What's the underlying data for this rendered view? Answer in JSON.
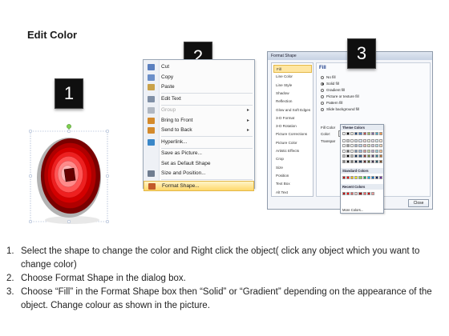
{
  "title": "Edit Color",
  "badges": [
    "1",
    "2",
    "3"
  ],
  "context_menu": {
    "items": [
      {
        "label": "Cut",
        "icon": "scissors-icon",
        "state": "normal"
      },
      {
        "label": "Copy",
        "icon": "copy-icon",
        "state": "normal"
      },
      {
        "label": "Paste",
        "icon": "paste-icon",
        "state": "normal"
      },
      {
        "label": "Edit Text",
        "icon": "edit-text-icon",
        "state": "normal"
      },
      {
        "label": "Group",
        "icon": "group-icon",
        "state": "disabled",
        "submenu": true
      },
      {
        "label": "Bring to Front",
        "icon": "bring-front-icon",
        "state": "normal",
        "submenu": true
      },
      {
        "label": "Send to Back",
        "icon": "send-back-icon",
        "state": "normal",
        "submenu": true
      },
      {
        "label": "Hyperlink...",
        "icon": "globe-icon",
        "state": "normal"
      },
      {
        "label": "Save as Picture...",
        "icon": "",
        "state": "normal"
      },
      {
        "label": "Set as Default Shape",
        "icon": "",
        "state": "normal"
      },
      {
        "label": "Size and Position...",
        "icon": "size-icon",
        "state": "normal"
      },
      {
        "label": "Format Shape...",
        "icon": "format-shape-icon",
        "state": "highlighted"
      }
    ]
  },
  "dialog": {
    "title": "Format Shape",
    "nav": [
      "Fill",
      "Line Color",
      "Line Style",
      "Shadow",
      "Reflection",
      "Glow and Soft Edges",
      "3-D Format",
      "3-D Rotation",
      "Picture Corrections",
      "Picture Color",
      "Artistic Effects",
      "Crop",
      "Size",
      "Position",
      "Text Box",
      "Alt Text"
    ],
    "selected_nav": "Fill",
    "fill_heading": "Fill",
    "options": [
      "No fill",
      "Solid fill",
      "Gradient fill",
      "Picture or texture fill",
      "Pattern fill",
      "Slide background fill"
    ],
    "selected_option": "Solid fill",
    "fill_color_label": "Fill Color",
    "color_label": "Color:",
    "transparency_label": "Transpar",
    "theme_colors_label": "Theme Colors",
    "standard_colors_label": "Standard Colors",
    "recent_colors_label": "Recent Colors",
    "more_colors_label": "More Colors...",
    "close_label": "Close",
    "theme_color_columns": [
      "#ffffff",
      "#000000",
      "#eeece1",
      "#1f497d",
      "#4f81bd",
      "#c0504d",
      "#9bbb59",
      "#8064a2",
      "#4bacc6",
      "#f79646"
    ],
    "standard_colors": [
      "#c00000",
      "#ff0000",
      "#ffc000",
      "#ffff00",
      "#92d050",
      "#00b050",
      "#00b0f0",
      "#0070c0",
      "#002060",
      "#7030a0"
    ],
    "recent_colors": [
      "#c00000",
      "#ff0000",
      "#e06666",
      "#f4cccc",
      "#990000",
      "#ff6666",
      "#cc0000",
      "#ff9999"
    ]
  },
  "shape": {
    "colors": [
      "#7a0000",
      "#b00000",
      "#d40000",
      "#ee2020",
      "#ff5555",
      "#ff8a8a",
      "#ffb4b4"
    ]
  },
  "instructions": [
    {
      "num": "1.",
      "text": "Select the shape to change the color and Right click the object( click any object which you want to change color)"
    },
    {
      "num": "2.",
      "text": "Choose Format Shape in the dialog box."
    },
    {
      "num": "3.",
      "text": "Choose “Fill” in the Format Shape box then “Solid” or “Gradient” depending on the appearance of the object. Change colour as shown in the picture."
    }
  ]
}
